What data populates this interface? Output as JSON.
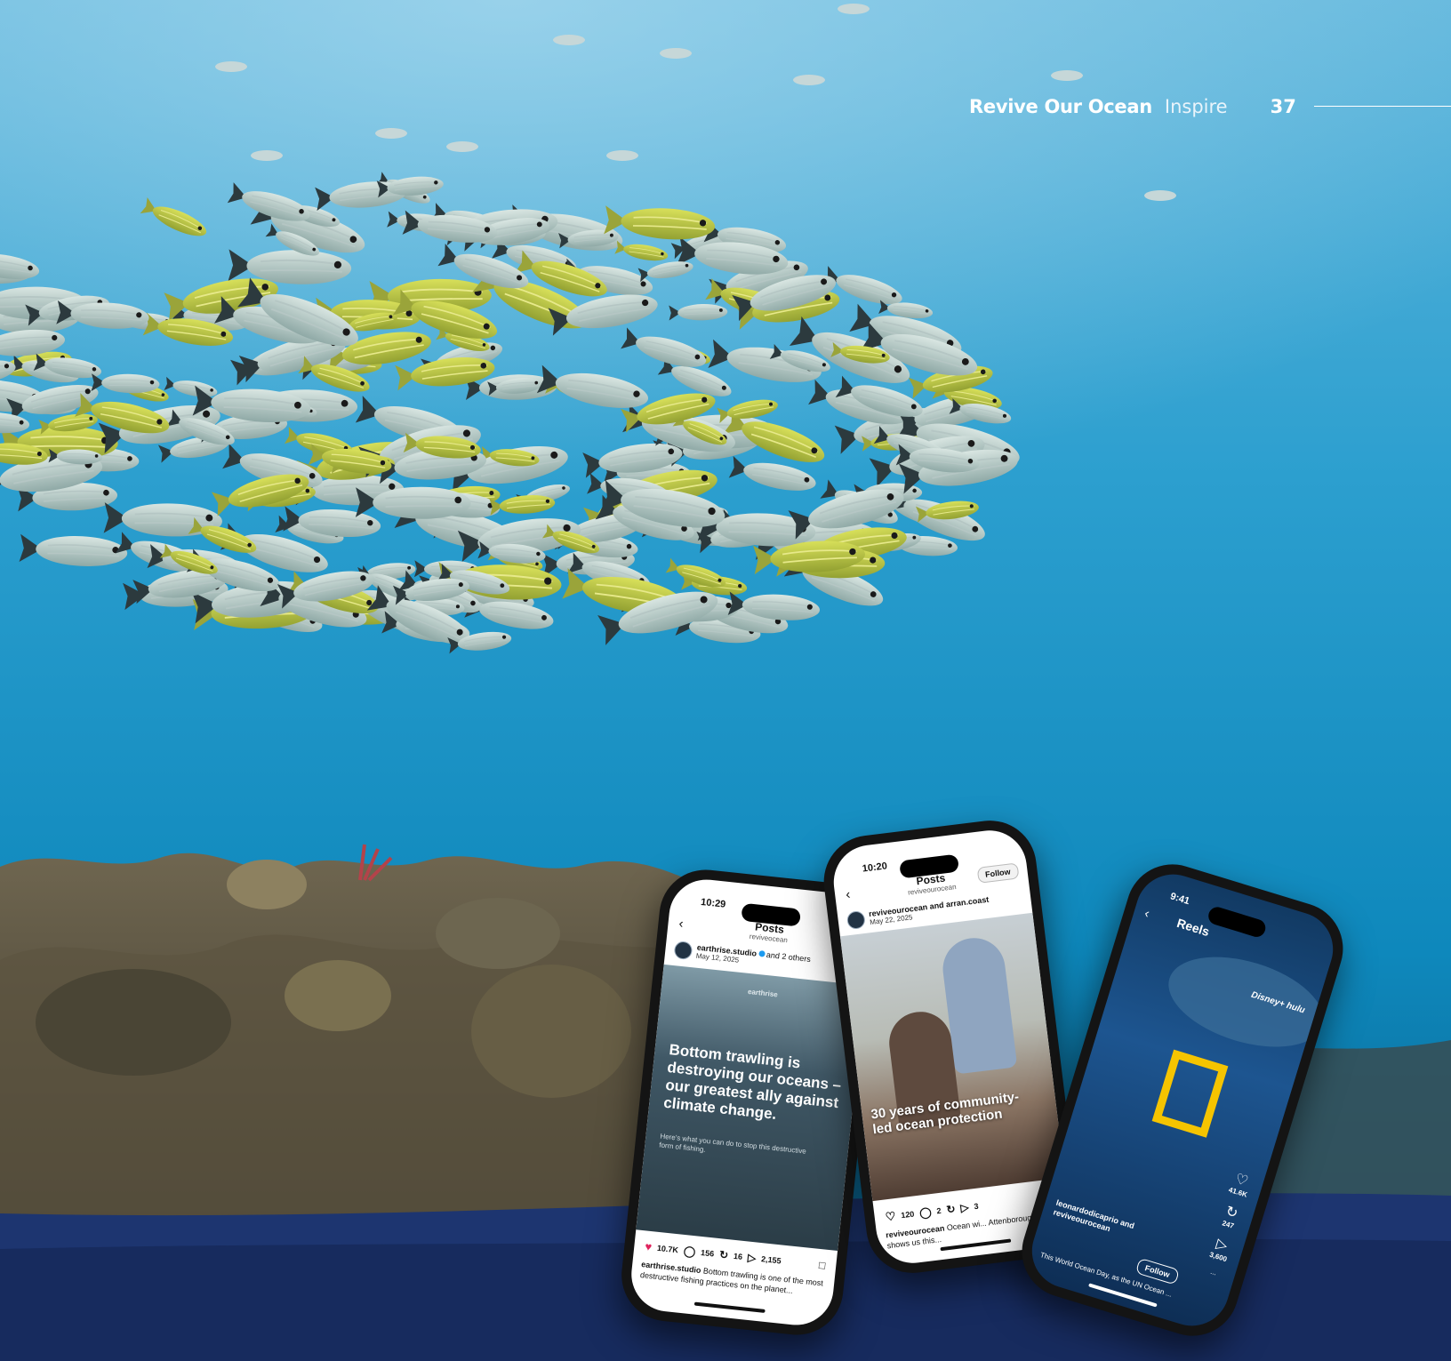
{
  "header": {
    "title": "Revive Our Ocean",
    "section": "Inspire",
    "page_number": "37"
  },
  "phone1": {
    "time": "10:29",
    "nav_title": "Posts",
    "nav_subtitle": "reviveocean",
    "author_name": "earthrise.studio",
    "author_others": "and 2 others",
    "date": "May 12, 2025",
    "brand": "earthrise",
    "headline": "Bottom trawling is destroying our oceans – our greatest ally against climate change.",
    "subtext": "Here's what you can do to stop this destructive form of fishing.",
    "likes": "10.7K",
    "comments": "156",
    "reposts": "16",
    "shares": "2,155",
    "caption_user": "earthrise.studio",
    "caption_text": "Bottom trawling is one of the most destructive fishing practices on the planet..."
  },
  "phone2": {
    "time": "10:20",
    "nav_title": "Posts",
    "nav_subtitle": "reviveourocean",
    "follow": "Follow",
    "author": "reviveourocean and arran.coast",
    "date": "May 22, 2025",
    "headline": "30 years of community-led ocean protection",
    "likes": "120",
    "comments": "2",
    "shares": "3",
    "caption_user": "reviveourocean",
    "caption_text": "Ocean wi... Attenborough shows us this..."
  },
  "phone3": {
    "time": "9:41",
    "title": "Reels",
    "brand": "Disney+ hulu",
    "likes": "41.6K",
    "reposts": "247",
    "shares": "3,600",
    "more": "...",
    "author": "leonardodicaprio and reviveourocean",
    "follow": "Follow",
    "caption": "This World Ocean Day, as the UN Ocean ..."
  }
}
